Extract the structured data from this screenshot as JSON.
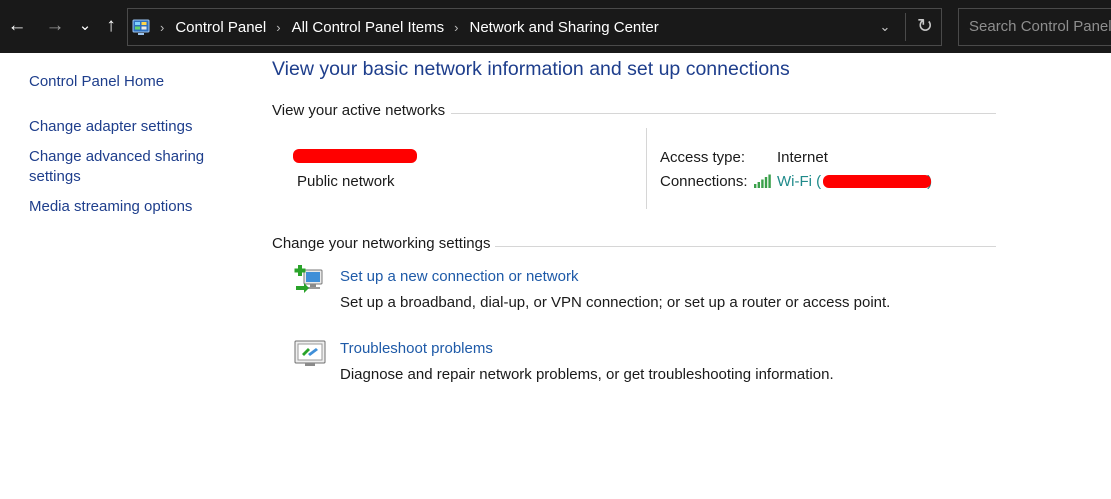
{
  "nav": {
    "back_glyph": "←",
    "forward_glyph": "→",
    "recent_glyph": "⌄",
    "up_glyph": "↑"
  },
  "address": {
    "icon": "control-panel-icon",
    "crumbs": [
      "Control Panel",
      "All Control Panel Items",
      "Network and Sharing Center"
    ],
    "separator_glyph": "›",
    "dropdown_glyph": "⌄",
    "refresh_glyph": "↻"
  },
  "search": {
    "placeholder": "Search Control Panel"
  },
  "sidebar": {
    "home": "Control Panel Home",
    "items": [
      {
        "label": "Change adapter settings"
      },
      {
        "label": "Change advanced sharing settings"
      },
      {
        "label": "Media streaming options"
      }
    ]
  },
  "main": {
    "title": "View your basic network information and set up connections",
    "active_header": "View your active networks",
    "network": {
      "type": "Public network",
      "access_label": "Access type:",
      "access_value": "Internet",
      "connections_label": "Connections:",
      "connection_link": "Wi-Fi (",
      "connection_link_end": ")"
    },
    "settings_header": "Change your networking settings",
    "tasks": [
      {
        "icon": "new-connection-icon",
        "link": "Set up a new connection or network",
        "description": "Set up a broadband, dial-up, or VPN connection; or set up a router or access point."
      },
      {
        "icon": "troubleshoot-icon",
        "link": "Troubleshoot problems",
        "description": "Diagnose and repair network problems, or get troubleshooting information."
      }
    ]
  },
  "colors": {
    "titlebar": "#191919",
    "link_blue": "#1e3e8c",
    "task_link": "#1e5aa8",
    "connection_teal": "#1f8a8a",
    "redaction": "#ff0000",
    "divider": "#d6d6d6"
  }
}
